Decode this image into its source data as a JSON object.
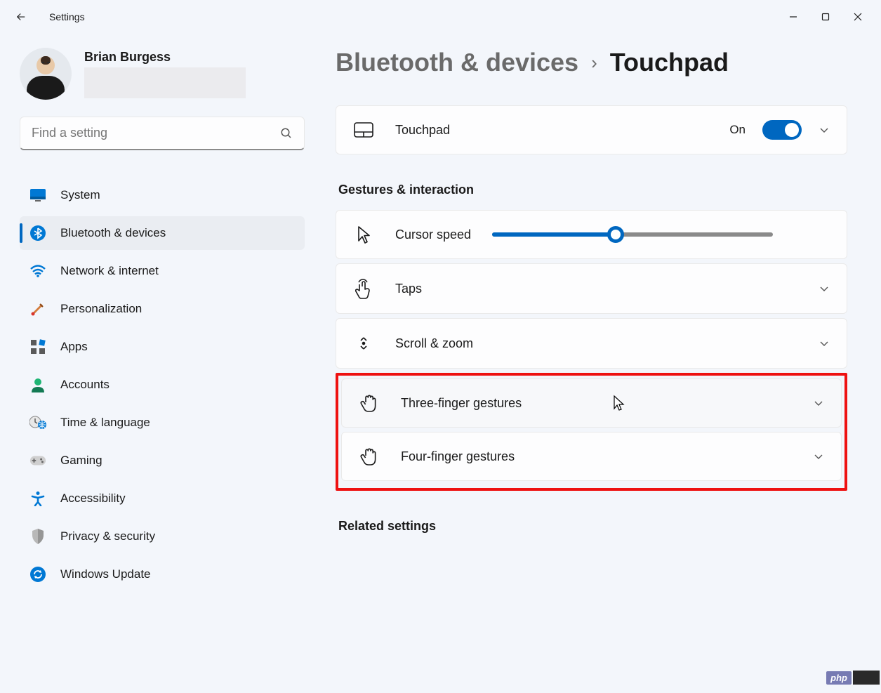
{
  "window": {
    "app_title": "Settings"
  },
  "profile": {
    "name": "Brian Burgess"
  },
  "search": {
    "placeholder": "Find a setting"
  },
  "nav": {
    "items": [
      {
        "label": "System"
      },
      {
        "label": "Bluetooth & devices"
      },
      {
        "label": "Network & internet"
      },
      {
        "label": "Personalization"
      },
      {
        "label": "Apps"
      },
      {
        "label": "Accounts"
      },
      {
        "label": "Time & language"
      },
      {
        "label": "Gaming"
      },
      {
        "label": "Accessibility"
      },
      {
        "label": "Privacy & security"
      },
      {
        "label": "Windows Update"
      }
    ]
  },
  "breadcrumb": {
    "parent": "Bluetooth & devices",
    "current": "Touchpad"
  },
  "touchpad_card": {
    "label": "Touchpad",
    "state_label": "On"
  },
  "section_gestures": "Gestures & interaction",
  "cursor_speed": {
    "label": "Cursor speed",
    "value_percent": 44
  },
  "cards": {
    "taps": "Taps",
    "scroll_zoom": "Scroll & zoom",
    "three_finger": "Three-finger gestures",
    "four_finger": "Four-finger gestures"
  },
  "section_related": "Related settings",
  "watermark": {
    "php": "php"
  }
}
